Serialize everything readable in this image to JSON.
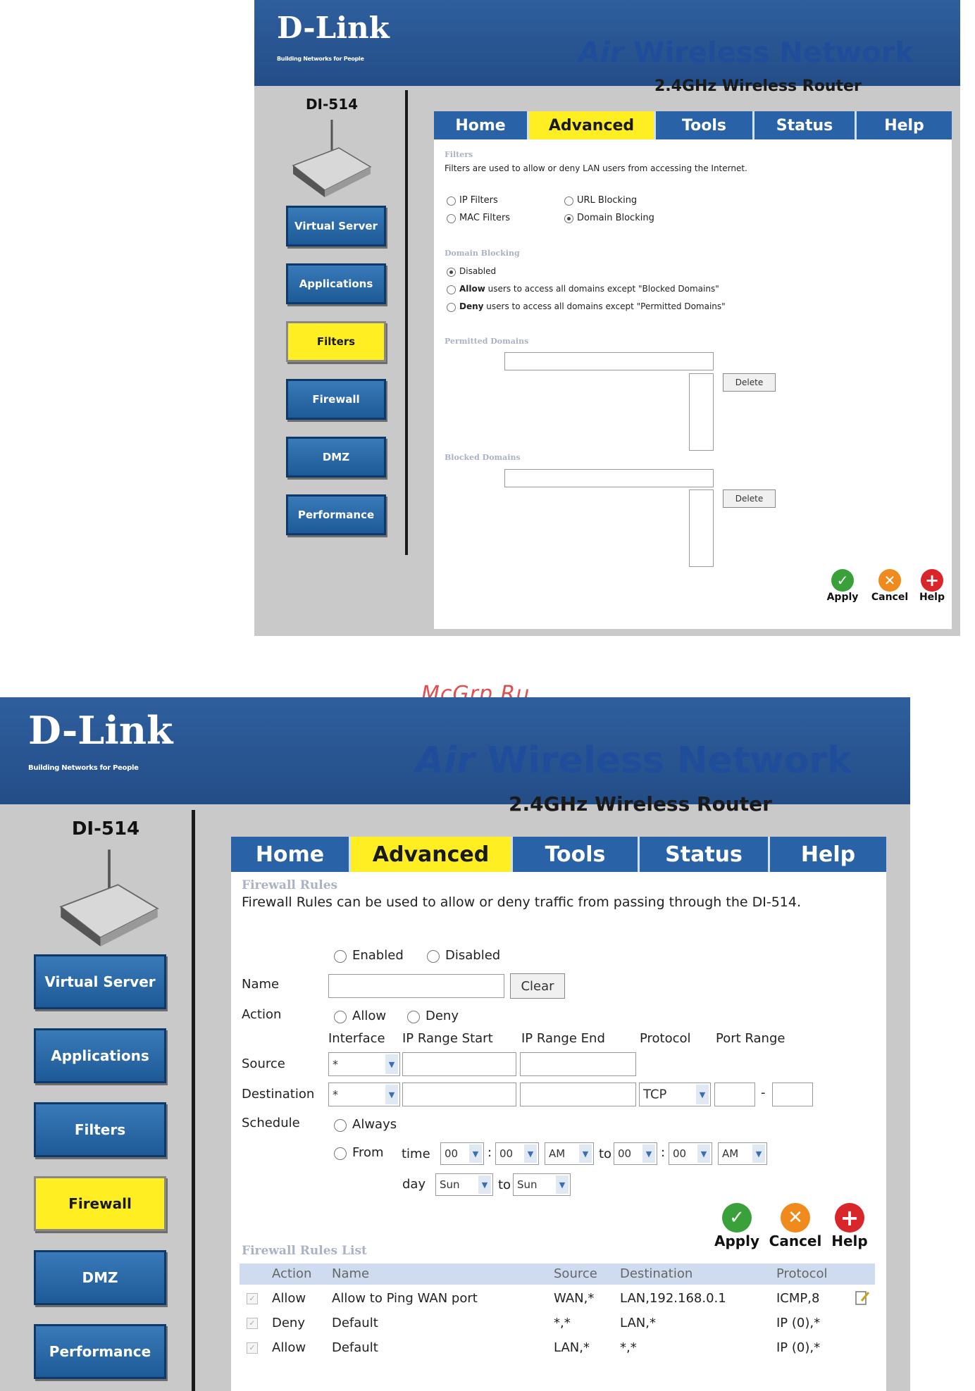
{
  "watermark": "McGrp.Ru",
  "header": {
    "brand": "D-Link",
    "tagline": "Building Networks for People",
    "product_air": "Air",
    "product_rest": " Wireless Network",
    "subtitle": "2.4GHz Wireless Router",
    "model": "DI-514"
  },
  "tabs": [
    "Home",
    "Advanced",
    "Tools",
    "Status",
    "Help"
  ],
  "actions": {
    "apply": "Apply",
    "cancel": "Cancel",
    "help": "Help"
  },
  "top": {
    "sidebar": [
      "Virtual Server",
      "Applications",
      "Filters",
      "Firewall",
      "DMZ",
      "Performance"
    ],
    "active_sidebar": "Filters",
    "filters_title": "Filters",
    "filters_desc": "Filters are used to allow or deny LAN users from accessing the Internet.",
    "filter_options": [
      "IP Filters",
      "URL Blocking",
      "MAC Filters",
      "Domain Blocking"
    ],
    "selected_filter": "Domain Blocking",
    "domain_title": "Domain Blocking",
    "domain_options": [
      {
        "bold": "",
        "text": "Disabled"
      },
      {
        "bold": "Allow",
        "text": " users to access all domains except \"Blocked Domains\""
      },
      {
        "bold": "Deny",
        "text": " users to access all domains except \"Permitted Domains\""
      }
    ],
    "selected_domain": "Disabled",
    "permitted_title": "Permitted Domains",
    "blocked_title": "Blocked Domains",
    "delete_label": "Delete"
  },
  "bottom": {
    "sidebar": [
      "Virtual Server",
      "Applications",
      "Filters",
      "Firewall",
      "DMZ",
      "Performance"
    ],
    "active_sidebar": "Firewall",
    "title": "Firewall Rules",
    "desc": "Firewall Rules can be used to allow or deny traffic from passing through the DI-514.",
    "enabled": "Enabled",
    "disabled": "Disabled",
    "name_label": "Name",
    "clear_label": "Clear",
    "action_label": "Action",
    "allow": "Allow",
    "deny": "Deny",
    "columns": [
      "Interface",
      "IP Range Start",
      "IP Range End",
      "Protocol",
      "Port Range"
    ],
    "source_label": "Source",
    "destination_label": "Destination",
    "source_interface": "*",
    "dest_interface": "*",
    "protocol": "TCP",
    "port_sep": "-",
    "schedule_label": "Schedule",
    "always": "Always",
    "from": "From",
    "time": "time",
    "to": "to",
    "day": "day",
    "time_from": [
      "00",
      "00",
      "AM"
    ],
    "time_to": [
      "00",
      "00",
      "AM"
    ],
    "colon": ":",
    "day_from": "Sun",
    "day_to": "Sun",
    "list_title": "Firewall Rules List",
    "list_headers": [
      "Action",
      "Name",
      "Source",
      "Destination",
      "Protocol"
    ],
    "rules": [
      {
        "action": "Allow",
        "name": "Allow to Ping WAN port",
        "source": "WAN,*",
        "destination": "LAN,192.168.0.1",
        "protocol": "ICMP,8"
      },
      {
        "action": "Deny",
        "name": "Default",
        "source": "*,*",
        "destination": "LAN,*",
        "protocol": "IP (0),*"
      },
      {
        "action": "Allow",
        "name": "Default",
        "source": "LAN,*",
        "destination": "*,*",
        "protocol": "IP (0),*"
      }
    ]
  }
}
